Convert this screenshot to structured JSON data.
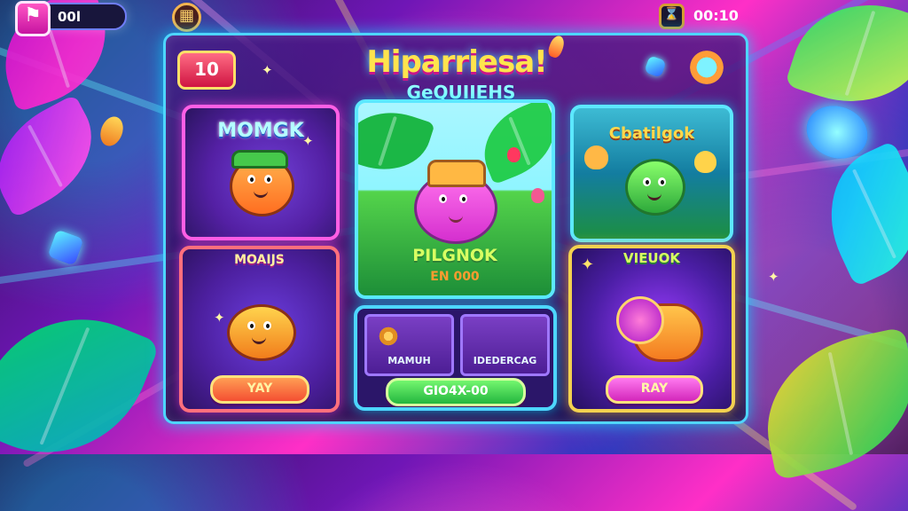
{
  "top_bar": {
    "left_icon": "⚑",
    "left_value": "00l",
    "shortcut_icon": "grid-icon",
    "timer_icon": "hourglass-icon",
    "timer_value": "00:10"
  },
  "header": {
    "level": "10",
    "title": "Hiparriesa!",
    "subtitle": "GeQUIIEHS"
  },
  "cards": {
    "monck": {
      "title": "MOMGK"
    },
    "center": {
      "title": "PILGNOK",
      "subtitle": "EN 000"
    },
    "right_top": {
      "title": "Cbatilgok"
    },
    "bottom_left": {
      "title": "MOAIJS",
      "button": "YAY"
    },
    "bottom_center": {
      "left_label": "MAMUH",
      "right_label": "IDEDERCAG",
      "button": "GIO4X-00"
    },
    "bottom_right": {
      "title": "VIEUOK",
      "button": "RAY"
    }
  },
  "colors": {
    "accent_cyan": "#4dd6ff",
    "accent_pink": "#ff5fe5",
    "accent_gold": "#f3d14f",
    "button_green": "#23b63f"
  }
}
